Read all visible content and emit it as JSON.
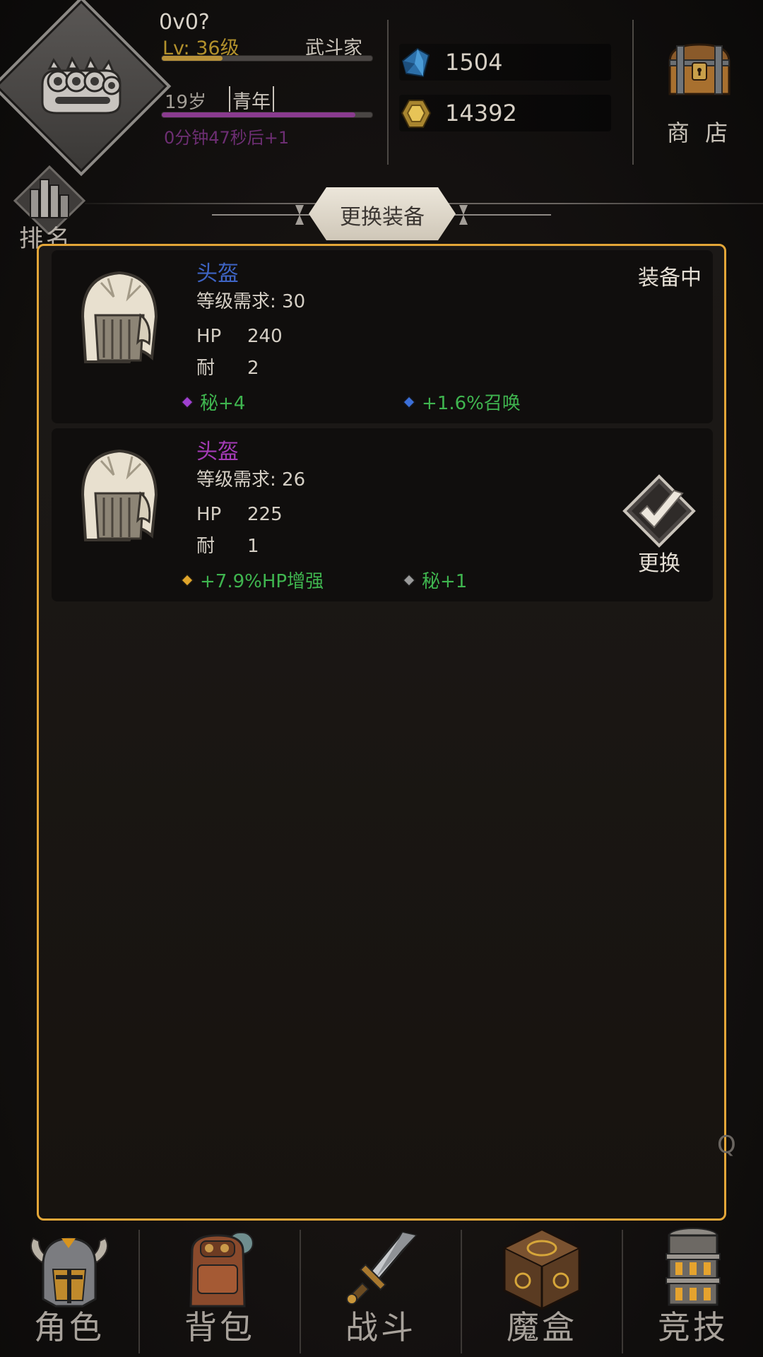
{
  "player": {
    "name": "0v0?",
    "level_text": "Lv: 36级",
    "class_name": "武斗家",
    "xp_fraction": 0.29,
    "age_text": "19岁",
    "life_stage": "青年",
    "age_fraction": 0.92,
    "age_timer": "0分钟47秒后+1"
  },
  "currency": {
    "gems": "1504",
    "gold": "14392"
  },
  "shop": {
    "label": "商 店"
  },
  "ranking": {
    "label": "排名"
  },
  "panel": {
    "title": "更换装备"
  },
  "items": [
    {
      "name": "头盔",
      "name_color": "#3e64c4",
      "requirement": "等级需求: 30",
      "hp_label": "HP",
      "hp_value": "240",
      "durability_label": "耐",
      "durability_value": "2",
      "affixes": [
        {
          "text": "秘+4",
          "gem_color": "#a040d0"
        },
        {
          "text": "+1.6%召唤",
          "gem_color": "#3b6fd8"
        }
      ],
      "status": "装备中"
    },
    {
      "name": "头盔",
      "name_color": "#a43bb6",
      "requirement": "等级需求: 26",
      "hp_label": "HP",
      "hp_value": "225",
      "durability_label": "耐",
      "durability_value": "1",
      "affixes": [
        {
          "text": "+7.9%HP增强",
          "gem_color": "#e0a52b"
        },
        {
          "text": "秘+1",
          "gem_color": "#9a9a9a"
        }
      ],
      "action_label": "更换"
    }
  ],
  "nav": [
    {
      "label": "角色",
      "icon": "helmet-icon",
      "active": true
    },
    {
      "label": "背包",
      "icon": "backpack-icon",
      "active": false
    },
    {
      "label": "战斗",
      "icon": "sword-icon",
      "active": false
    },
    {
      "label": "魔盒",
      "icon": "magic-box-icon",
      "active": false
    },
    {
      "label": "竞技",
      "icon": "tower-icon",
      "active": false
    }
  ],
  "misc": {
    "faint_glyph": "Q"
  },
  "colors": {
    "accent_border": "#e3a638",
    "affix_green": "#3fb54f",
    "xp_bar": "#b8923a",
    "age_bar": "#8a3b8f"
  }
}
